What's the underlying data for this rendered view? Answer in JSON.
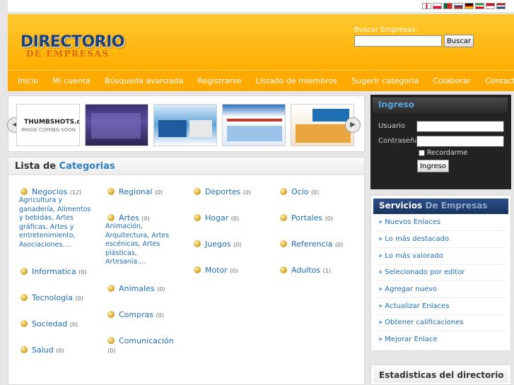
{
  "header": {
    "logo_main": "DIRECTORIO",
    "logo_sub": "DE EMPRESAS",
    "search_label": "Buscar Empresas:",
    "search_value": "",
    "search_button": "Buscar"
  },
  "flags": [
    {
      "name": "uk-flag",
      "color": "#c8102e"
    },
    {
      "name": "pl-flag",
      "color": "#dc143c"
    },
    {
      "name": "pt-flag",
      "color": "#046a38"
    },
    {
      "name": "ru-flag",
      "color": "#1c3578"
    },
    {
      "name": "de-flag",
      "color": "#dd0000"
    },
    {
      "name": "ir-flag",
      "color": "#239f40"
    },
    {
      "name": "id-flag",
      "color": "#ce1126"
    },
    {
      "name": "nl-flag",
      "color": "#21468b"
    }
  ],
  "nav": [
    "Inicio",
    "Mi cuenta",
    "Búsqueda avanzada",
    "Registrarse",
    "Listado de miembros",
    "Sugerir categoría",
    "Colaborar",
    "Contacto"
  ],
  "carousel": {
    "thumbshots_text": "THUMBSHOTS.com",
    "thumbshots_sub": "IMAGE COMING SOON"
  },
  "categories": {
    "title_prefix": "Lista de",
    "title_accent": "Categorias",
    "col1": [
      {
        "name": "Negocios",
        "count": "(12)",
        "subs": "Agricultura y ganadería, Alimentos y bebidas, Artes gráficas, Artes y entretenimiento, Asociaciones...."
      },
      {
        "name": "Informatica",
        "count": "(0)"
      },
      {
        "name": "Tecnologia",
        "count": "(0)"
      },
      {
        "name": "Sociedad",
        "count": "(0)"
      },
      {
        "name": "Salud",
        "count": "(0)"
      }
    ],
    "col2": [
      {
        "name": "Regional",
        "count": "(0)"
      },
      {
        "name": "Artes",
        "count": "(0)",
        "subs": "Animación, Arquitectura, Artes escénicas, Artes plásticas, Artesanía...."
      },
      {
        "name": "Animales",
        "count": "(0)"
      },
      {
        "name": "Compras",
        "count": "(0)"
      },
      {
        "name": "Comunicación",
        "count": "(0)"
      }
    ],
    "col3": [
      {
        "name": "Deportes",
        "count": "(0)"
      },
      {
        "name": "Hogar",
        "count": "(0)"
      },
      {
        "name": "Juegos",
        "count": "(0)"
      },
      {
        "name": "Motor",
        "count": "(0)"
      }
    ],
    "col4": [
      {
        "name": "Ocio",
        "count": "(0)"
      },
      {
        "name": "Portales",
        "count": "(0)"
      },
      {
        "name": "Referencia",
        "count": "(0)"
      },
      {
        "name": "Adultos",
        "count": "(1)"
      }
    ]
  },
  "login": {
    "title": "Ingreso",
    "user_label": "Usuario",
    "pass_label": "Contraseña",
    "remember": "Recordarme",
    "button": "Ingreso"
  },
  "services": {
    "title_main": "Servicios",
    "title_accent": "De Empresas",
    "links": [
      "» Nuevos Enlaces",
      "» Lo más destacado",
      "» Lo más valorado",
      "» Selecionado por editor",
      "» Agregar nuevo",
      "» Actualizar Enlaces",
      "» Obtener calificaciones",
      "» Mejorar Enlace"
    ]
  },
  "stats": {
    "title": "Estadisticas del directorio"
  }
}
